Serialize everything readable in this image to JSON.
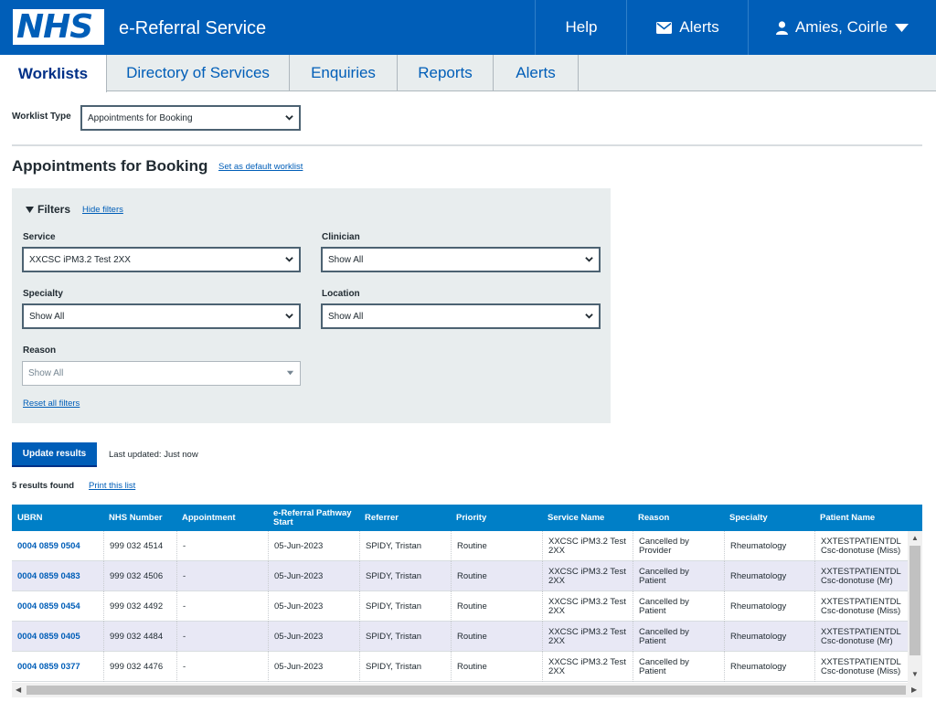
{
  "header": {
    "logo_text": "NHS",
    "service_name": "e-Referral Service",
    "help_label": "Help",
    "alerts_label": "Alerts",
    "user_name": "Amies, Coirle"
  },
  "tabs": [
    {
      "label": "Worklists",
      "active": true
    },
    {
      "label": "Directory of Services"
    },
    {
      "label": "Enquiries"
    },
    {
      "label": "Reports"
    },
    {
      "label": "Alerts"
    }
  ],
  "worklist_type": {
    "label": "Worklist Type",
    "value": "Appointments for Booking"
  },
  "page_title": "Appointments for Booking",
  "set_default_link": "Set as default worklist",
  "filters": {
    "title": "Filters",
    "hide_link": "Hide filters",
    "service": {
      "label": "Service",
      "value": "XXCSC iPM3.2 Test 2XX"
    },
    "clinician": {
      "label": "Clinician",
      "value": "Show All"
    },
    "specialty": {
      "label": "Specialty",
      "value": "Show All"
    },
    "location": {
      "label": "Location",
      "value": "Show All"
    },
    "reason": {
      "label": "Reason",
      "value": "Show All"
    },
    "reset_link": "Reset all filters"
  },
  "update_button": "Update results",
  "last_updated": "Last updated: Just now",
  "results_count": "5 results found",
  "print_link": "Print this list",
  "table": {
    "headers": [
      "UBRN",
      "NHS Number",
      "Appointment",
      "e-Referral Pathway Start",
      "Referrer",
      "Priority",
      "Service Name",
      "Reason",
      "Specialty",
      "Patient Name"
    ],
    "rows": [
      {
        "ubrn": "0004 0859 0504",
        "nhs": "999 032 4514",
        "appt": "-",
        "start": "05-Jun-2023",
        "referrer": "SPIDY, Tristan",
        "priority": "Routine",
        "service": "XXCSC iPM3.2 Test 2XX",
        "reason": "Cancelled by Provider",
        "specialty": "Rheumatology",
        "patient": "XXTESTPATIENTDL Csc-donotuse (Miss)"
      },
      {
        "ubrn": "0004 0859 0483",
        "nhs": "999 032 4506",
        "appt": "-",
        "start": "05-Jun-2023",
        "referrer": "SPIDY, Tristan",
        "priority": "Routine",
        "service": "XXCSC iPM3.2 Test 2XX",
        "reason": "Cancelled by Patient",
        "specialty": "Rheumatology",
        "patient": "XXTESTPATIENTDL Csc-donotuse (Mr)"
      },
      {
        "ubrn": "0004 0859 0454",
        "nhs": "999 032 4492",
        "appt": "-",
        "start": "05-Jun-2023",
        "referrer": "SPIDY, Tristan",
        "priority": "Routine",
        "service": "XXCSC iPM3.2 Test 2XX",
        "reason": "Cancelled by Patient",
        "specialty": "Rheumatology",
        "patient": "XXTESTPATIENTDL Csc-donotuse (Miss)"
      },
      {
        "ubrn": "0004 0859 0405",
        "nhs": "999 032 4484",
        "appt": "-",
        "start": "05-Jun-2023",
        "referrer": "SPIDY, Tristan",
        "priority": "Routine",
        "service": "XXCSC iPM3.2 Test 2XX",
        "reason": "Cancelled by Patient",
        "specialty": "Rheumatology",
        "patient": "XXTESTPATIENTDL Csc-donotuse (Mr)"
      },
      {
        "ubrn": "0004 0859 0377",
        "nhs": "999 032 4476",
        "appt": "-",
        "start": "05-Jun-2023",
        "referrer": "SPIDY, Tristan",
        "priority": "Routine",
        "service": "XXCSC iPM3.2 Test 2XX",
        "reason": "Cancelled by Patient",
        "specialty": "Rheumatology",
        "patient": "XXTESTPATIENTDL Csc-donotuse (Miss)"
      }
    ]
  }
}
